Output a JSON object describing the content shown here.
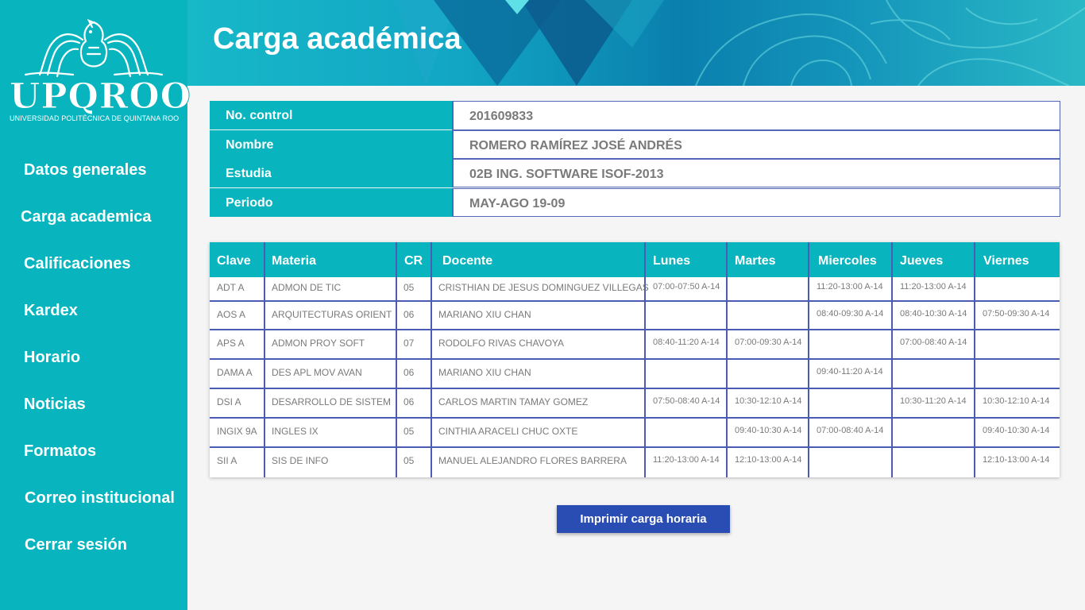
{
  "sidebar": {
    "logo_text": "UPQROO",
    "logo_subtitle": "UNIVERSIDAD POLITÉCNICA DE QUINTANA ROO",
    "nav": [
      {
        "label": "Datos generales"
      },
      {
        "label": "Carga academica"
      },
      {
        "label": "Calificaciones"
      },
      {
        "label": "Kardex"
      },
      {
        "label": "Horario"
      },
      {
        "label": "Noticias"
      },
      {
        "label": "Formatos"
      },
      {
        "label": "Correo institucional"
      },
      {
        "label": "Cerrar sesión"
      }
    ]
  },
  "header": {
    "title": "Carga académica"
  },
  "info": [
    {
      "label": "No. control",
      "value": "201609833"
    },
    {
      "label": "Nombre",
      "value": "ROMERO RAMÍREZ JOSÉ ANDRÉS"
    },
    {
      "label": "Estudia",
      "value": "02B ING. SOFTWARE ISOF-2013"
    },
    {
      "label": "Periodo",
      "value": "MAY-AGO 19-09"
    }
  ],
  "schedule": {
    "headers": [
      "Clave",
      "Materia",
      "CR",
      "Docente",
      "Lunes",
      "Martes",
      "Miercoles",
      "Jueves",
      "Viernes"
    ],
    "rows": [
      [
        "ADT A",
        "ADMON DE TIC",
        "05",
        "CRISTHIAN DE JESUS DOMINGUEZ VILLEGAS",
        "07:00-07:50 A-14",
        "",
        "11:20-13:00 A-14",
        "11:20-13:00 A-14",
        ""
      ],
      [
        "AOS A",
        "ARQUITECTURAS ORIENT",
        "06",
        "MARIANO XIU CHAN",
        "",
        "",
        "08:40-09:30 A-14",
        "08:40-10:30 A-14",
        "07:50-09:30 A-14"
      ],
      [
        "APS A",
        "ADMON PROY SOFT",
        "07",
        "RODOLFO RIVAS CHAVOYA",
        "08:40-11:20 A-14",
        "07:00-09:30 A-14",
        "",
        "07:00-08:40 A-14",
        ""
      ],
      [
        "DAMA A",
        "DES APL MOV AVAN",
        "06",
        "MARIANO XIU CHAN",
        "",
        "",
        "09:40-11:20 A-14",
        "",
        ""
      ],
      [
        "DSI A",
        "DESARROLLO DE SISTEM",
        "06",
        "CARLOS MARTIN TAMAY GOMEZ",
        "07:50-08:40 A-14",
        "10:30-12:10 A-14",
        "",
        "10:30-11:20 A-14",
        "10:30-12:10 A-14"
      ],
      [
        "INGIX 9A",
        "INGLES IX",
        "05",
        "CINTHIA ARACELI CHUC OXTE",
        "",
        "09:40-10:30 A-14",
        "07:00-08:40 A-14",
        "",
        "09:40-10:30 A-14"
      ],
      [
        "SII A",
        "SIS DE INFO",
        "05",
        "MANUEL ALEJANDRO FLORES BARRERA",
        "11:20-13:00 A-14",
        "12:10-13:00 A-14",
        "",
        "",
        "12:10-13:00 A-14"
      ]
    ]
  },
  "actions": {
    "print_label": "Imprimir carga horaria"
  },
  "colors": {
    "sidebar": "#08b4be",
    "table_lines": "#4a5cb4",
    "button": "#2a4db3"
  }
}
